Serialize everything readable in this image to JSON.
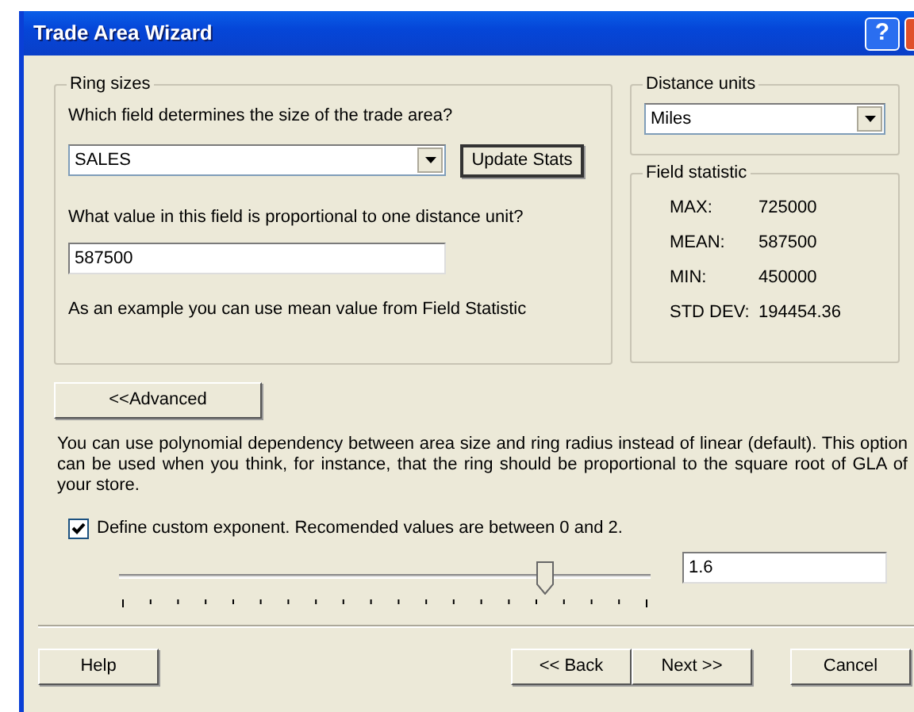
{
  "window": {
    "title": "Trade Area Wizard",
    "help_button": "?"
  },
  "ring_sizes": {
    "legend": "Ring sizes",
    "question": "Which field determines the size of the trade area?",
    "field_select": {
      "value": "SALES"
    },
    "update_button": "Update Stats",
    "value_question": "What value in this field is proportional to one distance unit?",
    "value_field": {
      "value": "587500"
    },
    "hint": "As an example you can use mean value from Field Statistic"
  },
  "distance_units": {
    "legend": "Distance units",
    "select": {
      "value": "Miles"
    }
  },
  "field_statistic": {
    "legend": "Field statistic",
    "rows": [
      {
        "label": "MAX:",
        "value": "725000"
      },
      {
        "label": "MEAN:",
        "value": "587500"
      },
      {
        "label": "MIN:",
        "value": "450000"
      },
      {
        "label": "STD DEV:",
        "value": "194454.36"
      }
    ]
  },
  "advanced_button": "<<Advanced",
  "description": "You can use polynomial dependency between area size and ring radius instead of linear (default). This option can be used when you think, for instance, that the ring should be proportional to the square root of GLA of your store.",
  "custom_exponent": {
    "checked": true,
    "label": "Define custom exponent. Recomended values are between 0 and 2."
  },
  "exponent_slider": {
    "level": 0.8,
    "value": "1.6"
  },
  "buttons": [
    {
      "label": "Help",
      "kind": "help"
    },
    {
      "label": "<< Back",
      "kind": "nav"
    },
    {
      "label": "Next >>",
      "kind": "nav"
    },
    {
      "label": "Cancel",
      "kind": "cancel"
    }
  ]
}
